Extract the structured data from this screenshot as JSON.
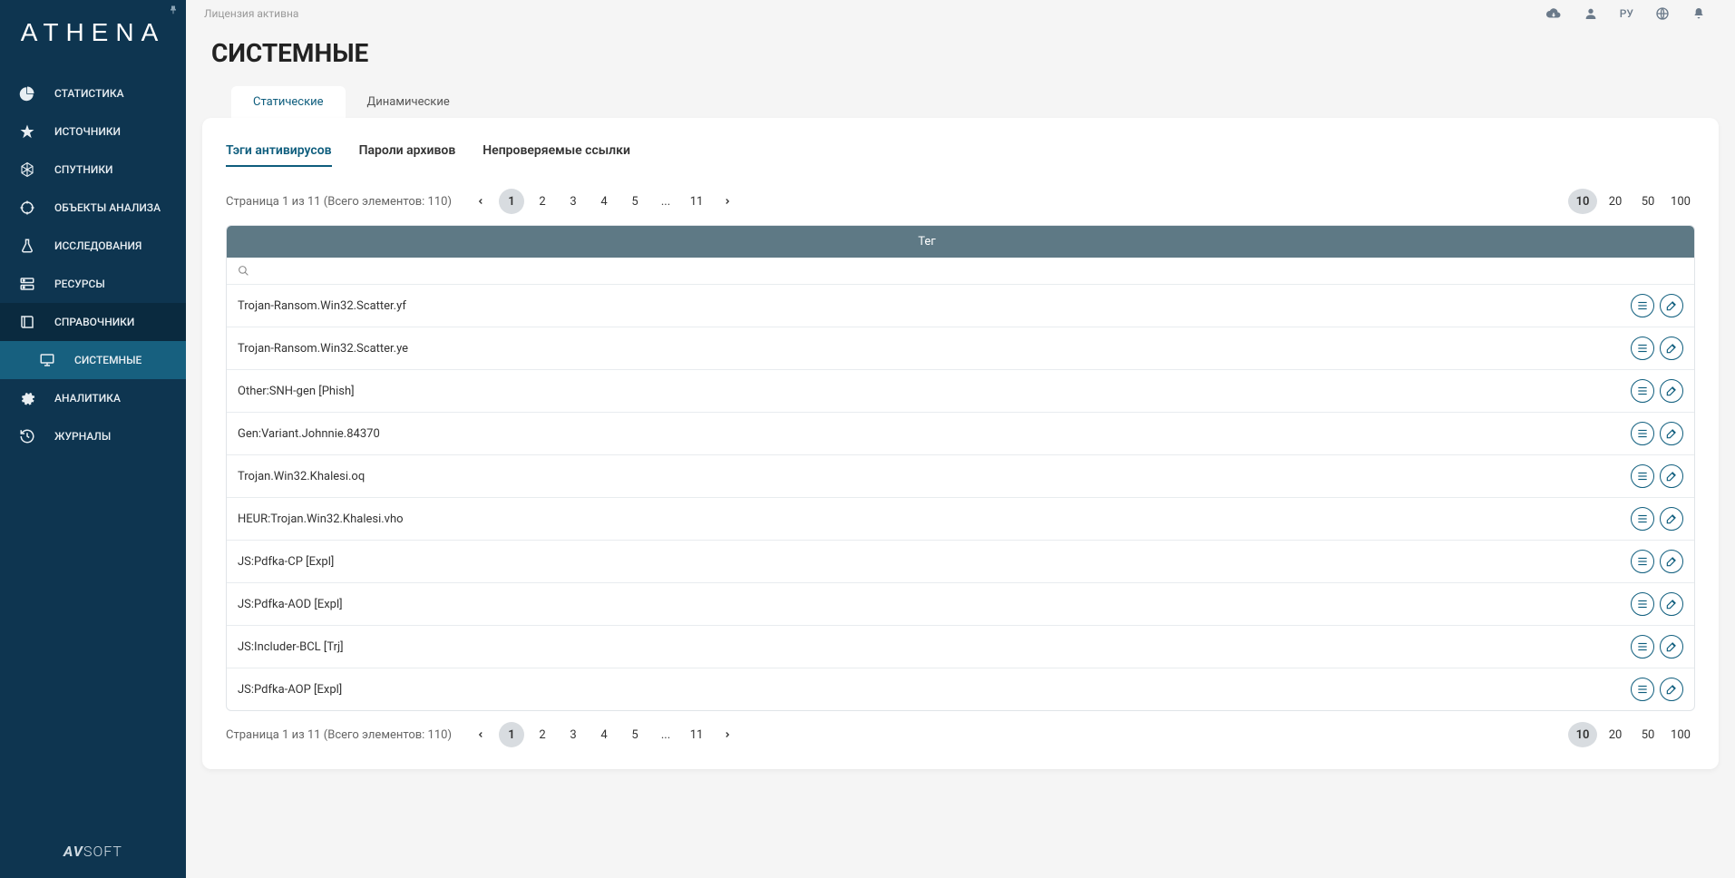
{
  "header": {
    "license_status": "Лицензия активна",
    "language": "РУ"
  },
  "logo": "ATHENA",
  "footer_logo": "AVSOFT",
  "sidebar": {
    "items": [
      {
        "label": "СТАТИСТИКА",
        "icon": "pie-chart-icon"
      },
      {
        "label": "ИСТОЧНИКИ",
        "icon": "star-icon"
      },
      {
        "label": "СПУТНИКИ",
        "icon": "hexagon-icon"
      },
      {
        "label": "ОБЪЕКТЫ АНАЛИЗА",
        "icon": "target-icon"
      },
      {
        "label": "ИССЛЕДОВАНИЯ",
        "icon": "flask-icon"
      },
      {
        "label": "РЕСУРСЫ",
        "icon": "server-icon"
      },
      {
        "label": "СПРАВОЧНИКИ",
        "icon": "book-icon"
      }
    ],
    "sub_item": {
      "label": "СИСТЕМНЫЕ",
      "icon": "monitor-icon"
    },
    "items_after": [
      {
        "label": "АНАЛИТИКА",
        "icon": "gear-icon"
      },
      {
        "label": "ЖУРНАЛЫ",
        "icon": "history-icon"
      }
    ]
  },
  "page_title": "СИСТЕМНЫЕ",
  "tabs_outer": [
    {
      "label": "Статические",
      "active": true
    },
    {
      "label": "Динамические",
      "active": false
    }
  ],
  "tabs_inner": [
    {
      "label": "Тэги антивирусов",
      "active": true
    },
    {
      "label": "Пароли архивов",
      "active": false
    },
    {
      "label": "Непроверяемые ссылки",
      "active": false
    }
  ],
  "pager": {
    "info": "Страница 1 из 11 (Всего элементов: 110)",
    "pages": [
      "1",
      "2",
      "3",
      "4",
      "5",
      "...",
      "11"
    ],
    "current_page": "1",
    "sizes": [
      "10",
      "20",
      "50",
      "100"
    ],
    "current_size": "10"
  },
  "table": {
    "header": "Тег",
    "rows": [
      "Trojan-Ransom.Win32.Scatter.yf",
      "Trojan-Ransom.Win32.Scatter.ye",
      "Other:SNH-gen [Phish]",
      "Gen:Variant.Johnnie.84370",
      "Trojan.Win32.Khalesi.oq",
      "HEUR:Trojan.Win32.Khalesi.vho",
      "JS:Pdfka-CP [Expl]",
      "JS:Pdfka-AOD [Expl]",
      "JS:Includer-BCL [Trj]",
      "JS:Pdfka-AOP [Expl]"
    ]
  }
}
